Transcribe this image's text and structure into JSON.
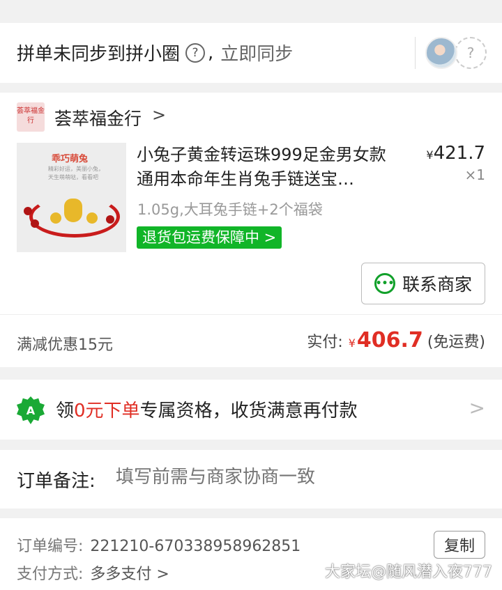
{
  "sync": {
    "text": "拼单未同步到拼小圈",
    "question": "?",
    "comma": ",",
    "link": "立即同步",
    "avatar_placeholder": "?"
  },
  "shop": {
    "logo_text": "荟萃福金行",
    "name": "荟萃福金行",
    "chevron": ">"
  },
  "product": {
    "image_title": "乖巧萌兔",
    "image_sub": "精彩好运，美丽小兔，天生萌萌哒，看看吧",
    "title": "小兔子黄金转运珠999足金男女款通用本命年生肖兔手链送宝…",
    "price_symbol": "¥",
    "price": "421.7",
    "qty": "×1",
    "spec": "1.05g,大耳兔手链+2个福袋",
    "badge": "退货包运费保障中 >"
  },
  "contact": {
    "icon_glyph": "•••",
    "label": "联系商家"
  },
  "summary": {
    "discount": "满减优惠15元",
    "paid_label": "实付:",
    "paid_symbol": "¥",
    "paid_amount": "406.7",
    "shipping_note": "(免运费)"
  },
  "promo": {
    "icon_glyph": "A",
    "text_pre": "领",
    "text_red": "0元下单",
    "text_post": "专属资格，收货满意再付款",
    "arrow": ">"
  },
  "remark": {
    "label": "订单备注:",
    "placeholder": "填写前需与商家协商一致"
  },
  "info": {
    "order_label": "订单编号:",
    "order_number": "221210-670338958962851",
    "copy_label": "复制",
    "pay_label": "支付方式:",
    "pay_value": "多多支付 >"
  },
  "watermark": "大家坛@随风潜入夜777",
  "colors": {
    "accent_red": "#e02e24",
    "badge_green": "#11b528",
    "background": "#f1f1f1"
  }
}
